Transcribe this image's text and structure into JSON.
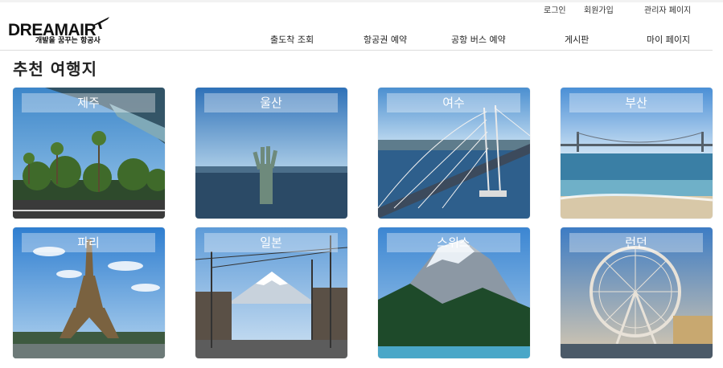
{
  "util_nav": {
    "login": "로그인",
    "signup": "회원가입",
    "admin": "관리자 페이지"
  },
  "logo": {
    "name": "DREAMAIR",
    "tagline": "개발을 꿈꾸는 항공사"
  },
  "main_nav": [
    "출도착 조회",
    "항공권 예약",
    "공항 버스 예약",
    "게시판",
    "마이 페이지"
  ],
  "section": {
    "title": "추천 여행지"
  },
  "destinations": [
    "제주",
    "울산",
    "여수",
    "부산",
    "파리",
    "일본",
    "스위스",
    "런던"
  ]
}
